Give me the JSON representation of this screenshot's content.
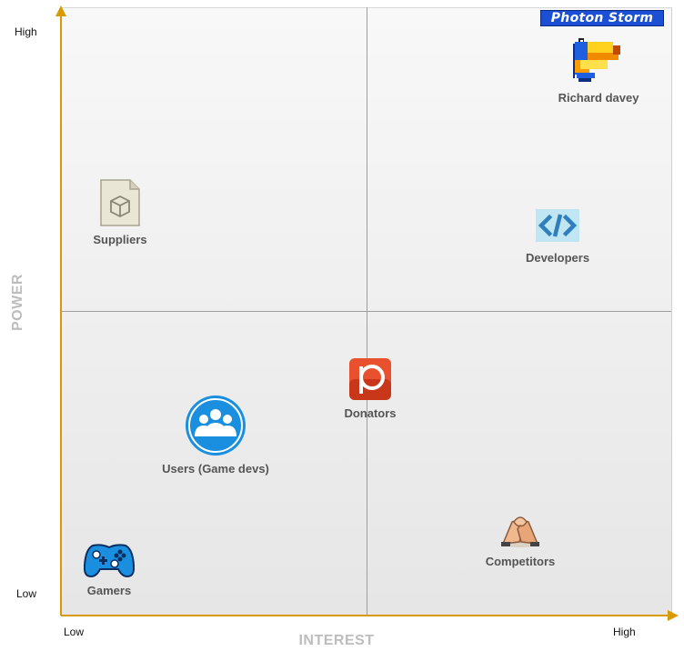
{
  "axes": {
    "y_title": "POWER",
    "x_title": "INTEREST",
    "y_high": "High",
    "y_low": "Low",
    "x_low": "Low",
    "x_high": "High"
  },
  "logo": {
    "text": "Photon Storm"
  },
  "stakeholders": {
    "richard": {
      "label": "Richard davey",
      "icon": "toucan-icon"
    },
    "suppliers": {
      "label": "Suppliers",
      "icon": "package-icon"
    },
    "developers": {
      "label": "Developers",
      "icon": "code-icon"
    },
    "donators": {
      "label": "Donators",
      "icon": "patreon-icon"
    },
    "users": {
      "label": "Users (Game devs)",
      "icon": "users-group-icon"
    },
    "competitors": {
      "label": "Competitors",
      "icon": "arm-wrestling-icon"
    },
    "gamers": {
      "label": "Gamers",
      "icon": "gamepad-icon"
    }
  },
  "colors": {
    "axis": "#d89a00",
    "quadrant_line": "#9e9e9e",
    "axis_title": "#bdbdbd"
  }
}
